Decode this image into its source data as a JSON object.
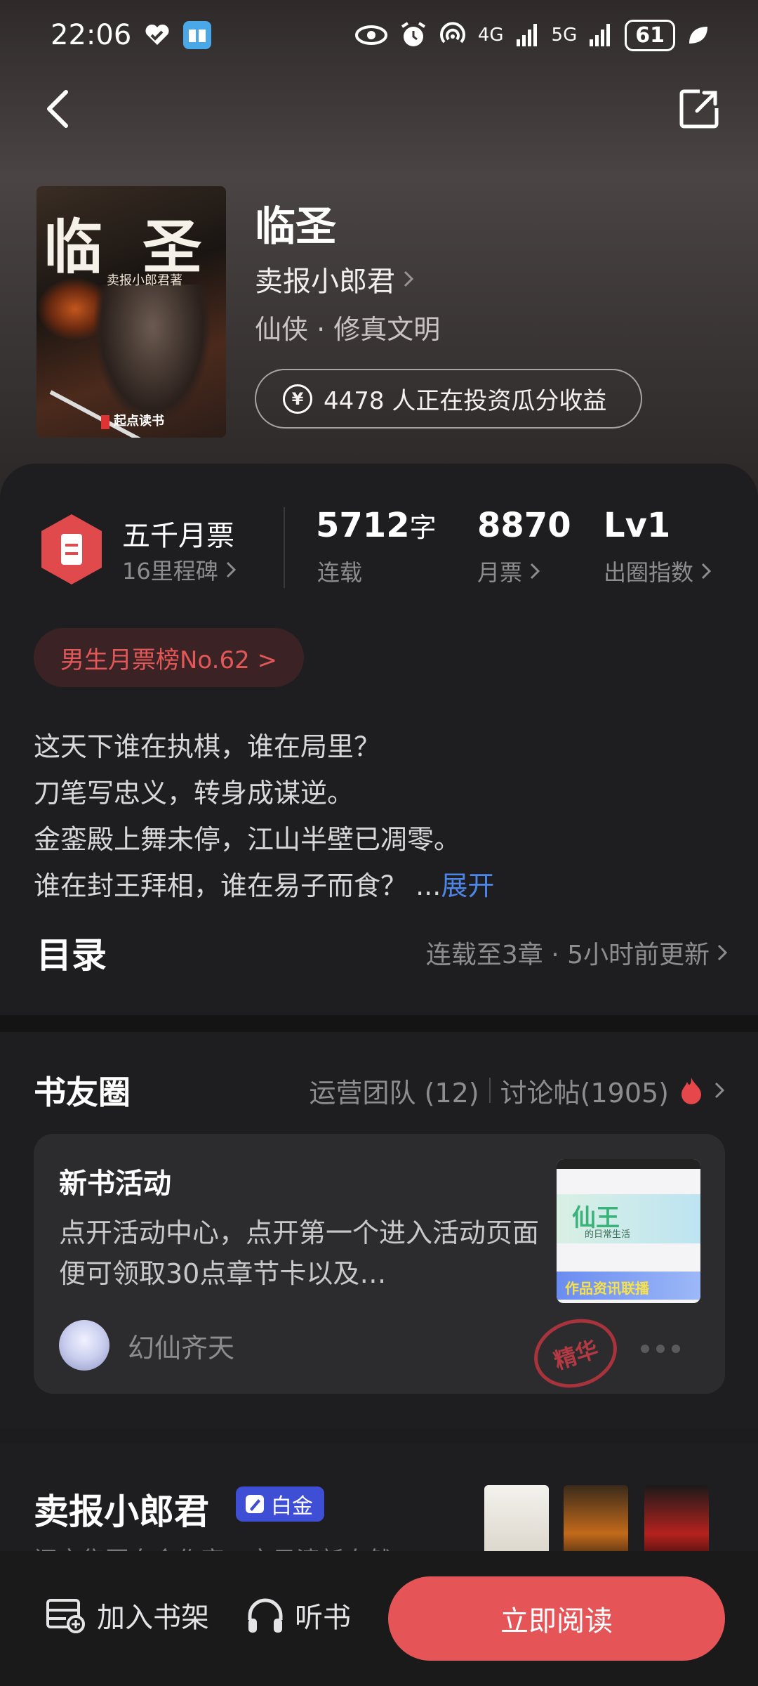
{
  "status_bar": {
    "time": "22:06",
    "signal_1": "4G",
    "signal_2": "5G",
    "battery": "61"
  },
  "book": {
    "cover_title": "临 圣",
    "cover_author": "卖报小郎君著",
    "cover_publisher": "起点读书",
    "title": "临圣",
    "author": "卖报小郎君",
    "genre": "仙侠 · 修真文明",
    "invest_text": "4478 人正在投资瓜分收益"
  },
  "stats": {
    "milestone_title": "五千月票",
    "milestone_sub": "16里程碑",
    "words_value": "5712",
    "words_unit": "字",
    "words_label": "连载",
    "tickets_value": "8870",
    "tickets_label": "月票",
    "level_value": "Lv1",
    "level_label": "出圈指数"
  },
  "rank_pill": "男生月票榜No.62 >",
  "synopsis": {
    "lines": [
      "这天下谁在执棋，谁在局里？",
      "刀笔写忠义，转身成谋逆。",
      "金銮殿上舞未停，江山半壁已凋零。",
      "谁在封王拜相，谁在易子而食？ ..."
    ],
    "expand": "展开"
  },
  "toc": {
    "title": "目录",
    "meta": "连载至3章 · 5小时前更新"
  },
  "circle": {
    "title": "书友圈",
    "team": "运营团队 (12)",
    "posts": "讨论帖(1905)",
    "card": {
      "title": "新书活动",
      "body": "点开活动中心，点开第一个进入活动页面便可领取30点章节卡以及…",
      "user": "幻仙齐天",
      "stamp": "精华",
      "thumb_main": "仙王",
      "thumb_sub": "的日常生活",
      "thumb_footer": "作品资讯联播"
    }
  },
  "author_section": {
    "name": "卖报小郎君",
    "badge": "白金",
    "desc": "阅文集团白金作家，文风清新自然"
  },
  "bottom_bar": {
    "shelf": "加入书架",
    "listen": "听书",
    "read": "立即阅读"
  },
  "colors": {
    "accent_red": "#e55457",
    "link_blue": "#4c86e8",
    "rank_red": "#e25858",
    "platinum_blue": "#3e4fd6"
  }
}
